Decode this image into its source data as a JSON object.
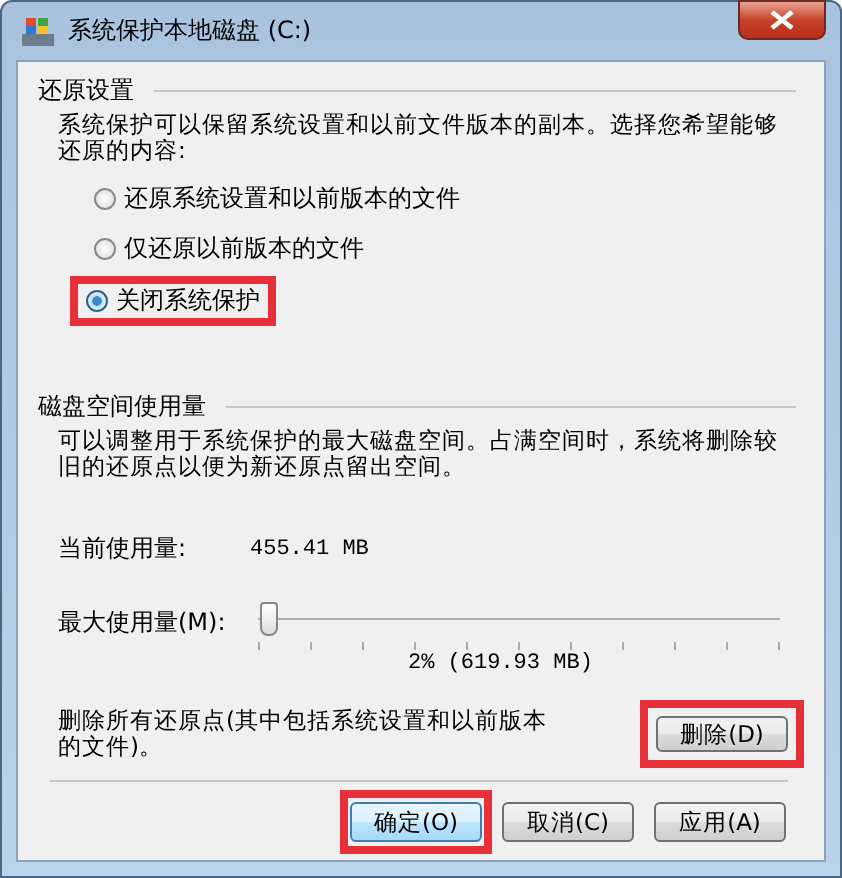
{
  "window": {
    "title": "系统保护本地磁盘 (C:)"
  },
  "restore_settings": {
    "heading": "还原设置",
    "description": "系统保护可以保留系统设置和以前文件版本的副本。选择您希望能够还原的内容:",
    "options": [
      {
        "label": "还原系统设置和以前版本的文件",
        "selected": false,
        "highlighted": false
      },
      {
        "label": "仅还原以前版本的文件",
        "selected": false,
        "highlighted": false
      },
      {
        "label": "关闭系统保护",
        "selected": true,
        "highlighted": true
      }
    ]
  },
  "disk_usage": {
    "heading": "磁盘空间使用量",
    "description": "可以调整用于系统保护的最大磁盘空间。占满空间时，系统将删除较旧的还原点以便为新还原点留出空间。",
    "current_label": "当前使用量:",
    "current_value": "455.41 MB",
    "max_label": "最大使用量(M):",
    "slider": {
      "level": 0.02
    },
    "slider_reading": "2% (619.93 MB)",
    "delete_text": "删除所有还原点(其中包括系统设置和以前版本的文件)。",
    "delete_button": {
      "label": "删除(D)",
      "highlighted": true
    }
  },
  "buttons": [
    {
      "label": "确定(O)",
      "highlighted": true
    },
    {
      "label": "取消(C)",
      "highlighted": false
    },
    {
      "label": "应用(A)",
      "highlighted": false
    }
  ]
}
